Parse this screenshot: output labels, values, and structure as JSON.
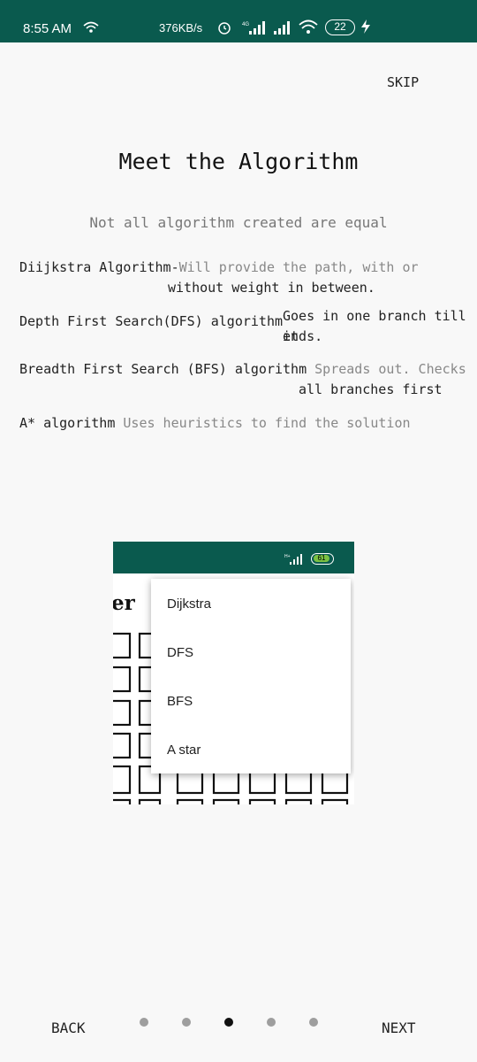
{
  "status_bar": {
    "time": "8:55 AM",
    "speed": "376KB/s",
    "battery": "22",
    "network": "4G"
  },
  "header": {
    "skip_label": "SKIP"
  },
  "content": {
    "title": "Meet the Algorithm",
    "subtitle": "Not all algorithm created are equal",
    "items": [
      {
        "name": "Diijkstra Algorithm-",
        "desc_line1": "Will provide the path, with or",
        "desc_line2": "without weight in between."
      },
      {
        "name": "Depth First Search(DFS) algorithm",
        "desc_line1": "Goes in one branch till it",
        "desc_line2": "ends."
      },
      {
        "name": "Breadth First Search (BFS) algorithm",
        "desc_line1": "Spreads out. Checks",
        "desc_line2": "all branches first"
      },
      {
        "name": "A* algorithm",
        "desc_line1": "Uses heuristics to find the solution"
      }
    ]
  },
  "preview": {
    "battery": "61",
    "partial_title": "er",
    "dropdown_options": [
      "Dijkstra",
      "DFS",
      "BFS",
      "A star"
    ]
  },
  "footer": {
    "back_label": "BACK",
    "next_label": "NEXT",
    "page_count": 5,
    "active_page": 3
  },
  "colors": {
    "status_bar": "#0a5a4e",
    "inactive_dot": "#9e9e9e",
    "active_dot": "#111111"
  }
}
